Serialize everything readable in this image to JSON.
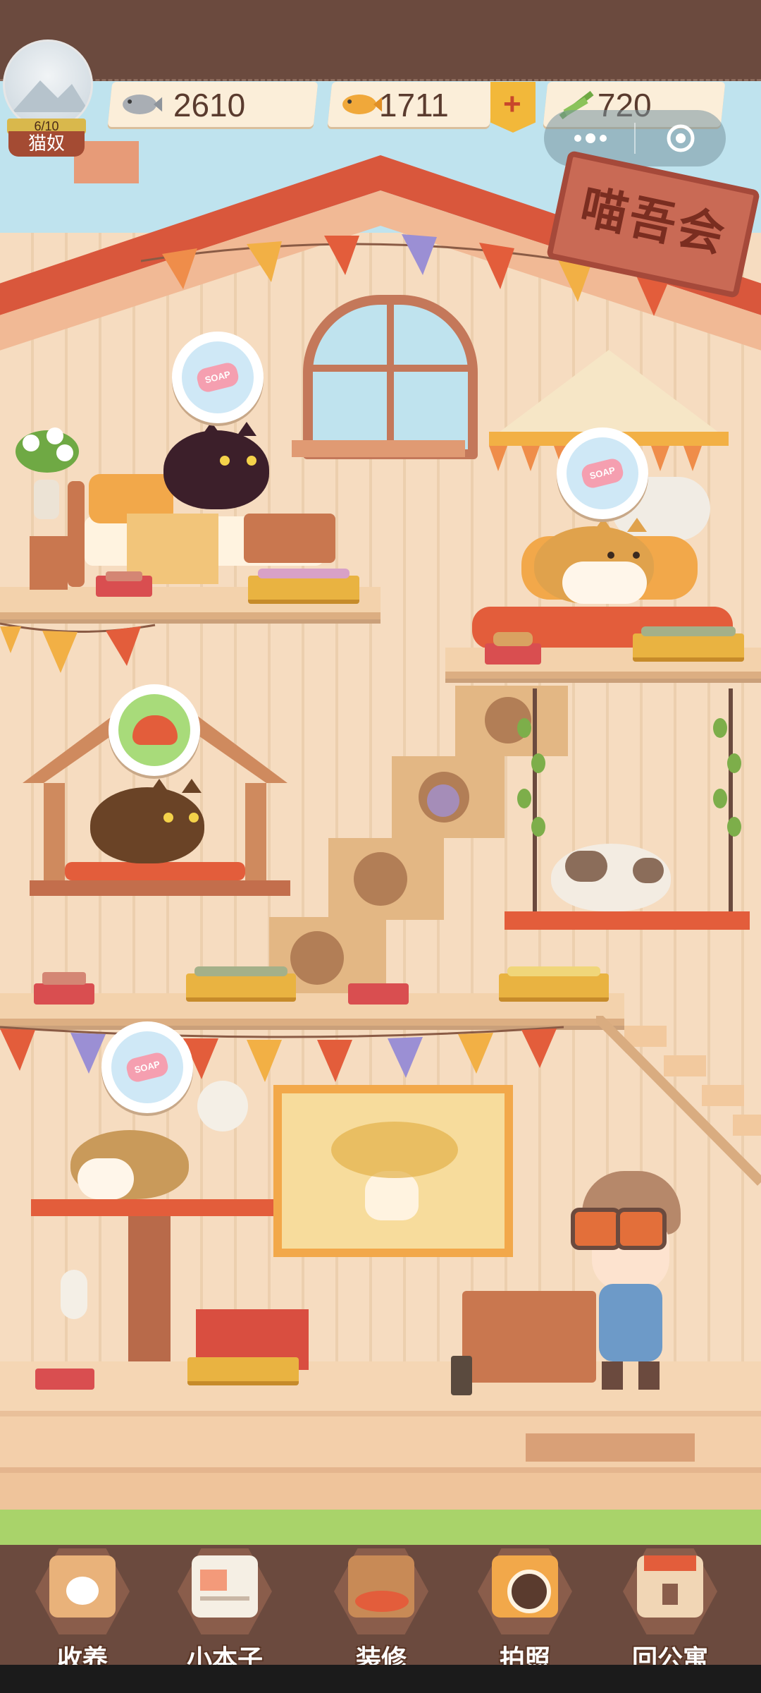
{
  "player": {
    "level_progress": "6/10",
    "level_fraction": 0.6,
    "title": "猫奴"
  },
  "currencies": [
    {
      "name": "fish-bone-icon",
      "value": "2610"
    },
    {
      "name": "dried-fish-icon",
      "value": "1711"
    },
    {
      "name": "catnip-icon",
      "value": "720"
    }
  ],
  "add_button_icon": "plus-icon",
  "club_sign": "喵吾会",
  "cat_requests": [
    {
      "cat": "black-cat",
      "request": "soap"
    },
    {
      "cat": "tabby-cat-on-cushion",
      "request": "soap"
    },
    {
      "cat": "brown-cat-in-house",
      "request": "food-bowl"
    },
    {
      "cat": "calico-cat-on-table",
      "request": "soap"
    }
  ],
  "bubble_text": "SOAP",
  "tabs": [
    {
      "id": "adopt",
      "label": "收养",
      "icon": "cat-box-icon"
    },
    {
      "id": "notebook",
      "label": "小本子",
      "icon": "notebook-icon"
    },
    {
      "id": "decorate",
      "label": "装修",
      "icon": "paint-brush-icon"
    },
    {
      "id": "photo",
      "label": "拍照",
      "icon": "camera-icon"
    },
    {
      "id": "apartment",
      "label": "回公寓",
      "icon": "house-icon"
    }
  ],
  "colors": {
    "frame": "#6b4a3e",
    "wall": "#f6dcc0",
    "roof": "#d9573c",
    "bowl": "#d94e50",
    "grass": "#a9d36a"
  }
}
